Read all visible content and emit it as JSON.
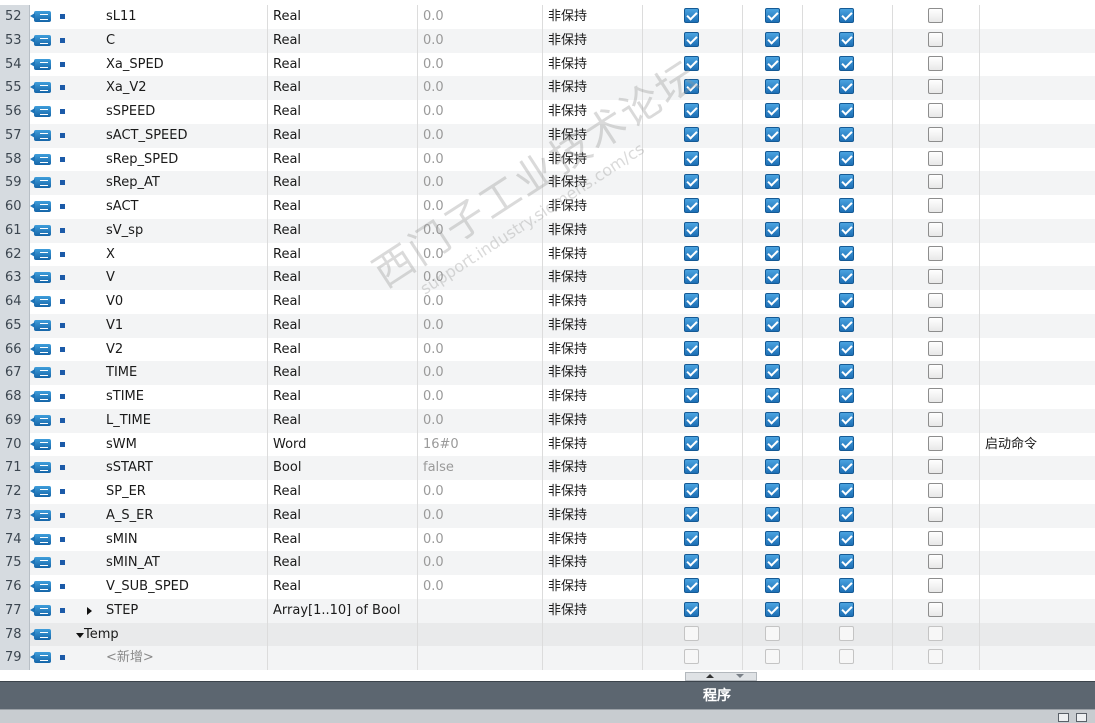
{
  "table": {
    "rows": [
      {
        "num": "52",
        "name": "sL11",
        "type": "Real",
        "default": "0.0",
        "retain": "非保持",
        "cb": [
          true,
          true,
          true,
          false
        ],
        "comment": ""
      },
      {
        "num": "53",
        "name": "C",
        "type": "Real",
        "default": "0.0",
        "retain": "非保持",
        "cb": [
          true,
          true,
          true,
          false
        ],
        "comment": ""
      },
      {
        "num": "54",
        "name": "Xa_SPED",
        "type": "Real",
        "default": "0.0",
        "retain": "非保持",
        "cb": [
          true,
          true,
          true,
          false
        ],
        "comment": ""
      },
      {
        "num": "55",
        "name": "Xa_V2",
        "type": "Real",
        "default": "0.0",
        "retain": "非保持",
        "cb": [
          true,
          true,
          true,
          false
        ],
        "comment": ""
      },
      {
        "num": "56",
        "name": "sSPEED",
        "type": "Real",
        "default": "0.0",
        "retain": "非保持",
        "cb": [
          true,
          true,
          true,
          false
        ],
        "comment": ""
      },
      {
        "num": "57",
        "name": "sACT_SPEED",
        "type": "Real",
        "default": "0.0",
        "retain": "非保持",
        "cb": [
          true,
          true,
          true,
          false
        ],
        "comment": ""
      },
      {
        "num": "58",
        "name": "sRep_SPED",
        "type": "Real",
        "default": "0.0",
        "retain": "非保持",
        "cb": [
          true,
          true,
          true,
          false
        ],
        "comment": ""
      },
      {
        "num": "59",
        "name": "sRep_AT",
        "type": "Real",
        "default": "0.0",
        "retain": "非保持",
        "cb": [
          true,
          true,
          true,
          false
        ],
        "comment": ""
      },
      {
        "num": "60",
        "name": "sACT",
        "type": "Real",
        "default": "0.0",
        "retain": "非保持",
        "cb": [
          true,
          true,
          true,
          false
        ],
        "comment": ""
      },
      {
        "num": "61",
        "name": "sV_sp",
        "type": "Real",
        "default": "0.0",
        "retain": "非保持",
        "cb": [
          true,
          true,
          true,
          false
        ],
        "comment": ""
      },
      {
        "num": "62",
        "name": "X",
        "type": "Real",
        "default": "0.0",
        "retain": "非保持",
        "cb": [
          true,
          true,
          true,
          false
        ],
        "comment": ""
      },
      {
        "num": "63",
        "name": "V",
        "type": "Real",
        "default": "0.0",
        "retain": "非保持",
        "cb": [
          true,
          true,
          true,
          false
        ],
        "comment": ""
      },
      {
        "num": "64",
        "name": "V0",
        "type": "Real",
        "default": "0.0",
        "retain": "非保持",
        "cb": [
          true,
          true,
          true,
          false
        ],
        "comment": ""
      },
      {
        "num": "65",
        "name": "V1",
        "type": "Real",
        "default": "0.0",
        "retain": "非保持",
        "cb": [
          true,
          true,
          true,
          false
        ],
        "comment": ""
      },
      {
        "num": "66",
        "name": "V2",
        "type": "Real",
        "default": "0.0",
        "retain": "非保持",
        "cb": [
          true,
          true,
          true,
          false
        ],
        "comment": ""
      },
      {
        "num": "67",
        "name": "TIME",
        "type": "Real",
        "default": "0.0",
        "retain": "非保持",
        "cb": [
          true,
          true,
          true,
          false
        ],
        "comment": ""
      },
      {
        "num": "68",
        "name": "sTIME",
        "type": "Real",
        "default": "0.0",
        "retain": "非保持",
        "cb": [
          true,
          true,
          true,
          false
        ],
        "comment": ""
      },
      {
        "num": "69",
        "name": "L_TIME",
        "type": "Real",
        "default": "0.0",
        "retain": "非保持",
        "cb": [
          true,
          true,
          true,
          false
        ],
        "comment": ""
      },
      {
        "num": "70",
        "name": "sWM",
        "type": "Word",
        "default": "16#0",
        "retain": "非保持",
        "cb": [
          true,
          true,
          true,
          false
        ],
        "comment": "启动命令"
      },
      {
        "num": "71",
        "name": "sSTART",
        "type": "Bool",
        "default": "false",
        "retain": "非保持",
        "cb": [
          true,
          true,
          true,
          false
        ],
        "comment": ""
      },
      {
        "num": "72",
        "name": "SP_ER",
        "type": "Real",
        "default": "0.0",
        "retain": "非保持",
        "cb": [
          true,
          true,
          true,
          false
        ],
        "comment": ""
      },
      {
        "num": "73",
        "name": "A_S_ER",
        "type": "Real",
        "default": "0.0",
        "retain": "非保持",
        "cb": [
          true,
          true,
          true,
          false
        ],
        "comment": ""
      },
      {
        "num": "74",
        "name": "sMIN",
        "type": "Real",
        "default": "0.0",
        "retain": "非保持",
        "cb": [
          true,
          true,
          true,
          false
        ],
        "comment": ""
      },
      {
        "num": "75",
        "name": "sMIN_AT",
        "type": "Real",
        "default": "0.0",
        "retain": "非保持",
        "cb": [
          true,
          true,
          true,
          false
        ],
        "comment": ""
      },
      {
        "num": "76",
        "name": "V_SUB_SPED",
        "type": "Real",
        "default": "0.0",
        "retain": "非保持",
        "cb": [
          true,
          true,
          true,
          false
        ],
        "comment": ""
      },
      {
        "num": "77",
        "name": "STEP",
        "type": "Array[1..10] of Bool",
        "default": "",
        "retain": "非保持",
        "cb": [
          true,
          true,
          true,
          false
        ],
        "comment": "",
        "expander": "collapsed"
      },
      {
        "num": "78",
        "name": "Temp",
        "type": "",
        "default": "",
        "retain": "",
        "cb": [
          null,
          null,
          null,
          null
        ],
        "comment": "",
        "section": true
      },
      {
        "num": "79",
        "name": "<新增>",
        "type": "",
        "default": "",
        "retain": "",
        "cb": [
          null,
          null,
          null,
          null
        ],
        "comment": "",
        "placeholder": true
      }
    ]
  },
  "section_bar": {
    "title": "程序"
  },
  "watermark": {
    "line1": "西门子工业技术论坛",
    "line2": "support.industry.siemens.com/cs"
  },
  "icons": {
    "interface": "interface-icon",
    "member": "member-square-icon",
    "expand": "expand-arrow-icon"
  },
  "colors": {
    "checkbox_checked": "#1d6fb5",
    "section_bar": "#5c6670",
    "row_number_bg": "#d6dbe0"
  }
}
